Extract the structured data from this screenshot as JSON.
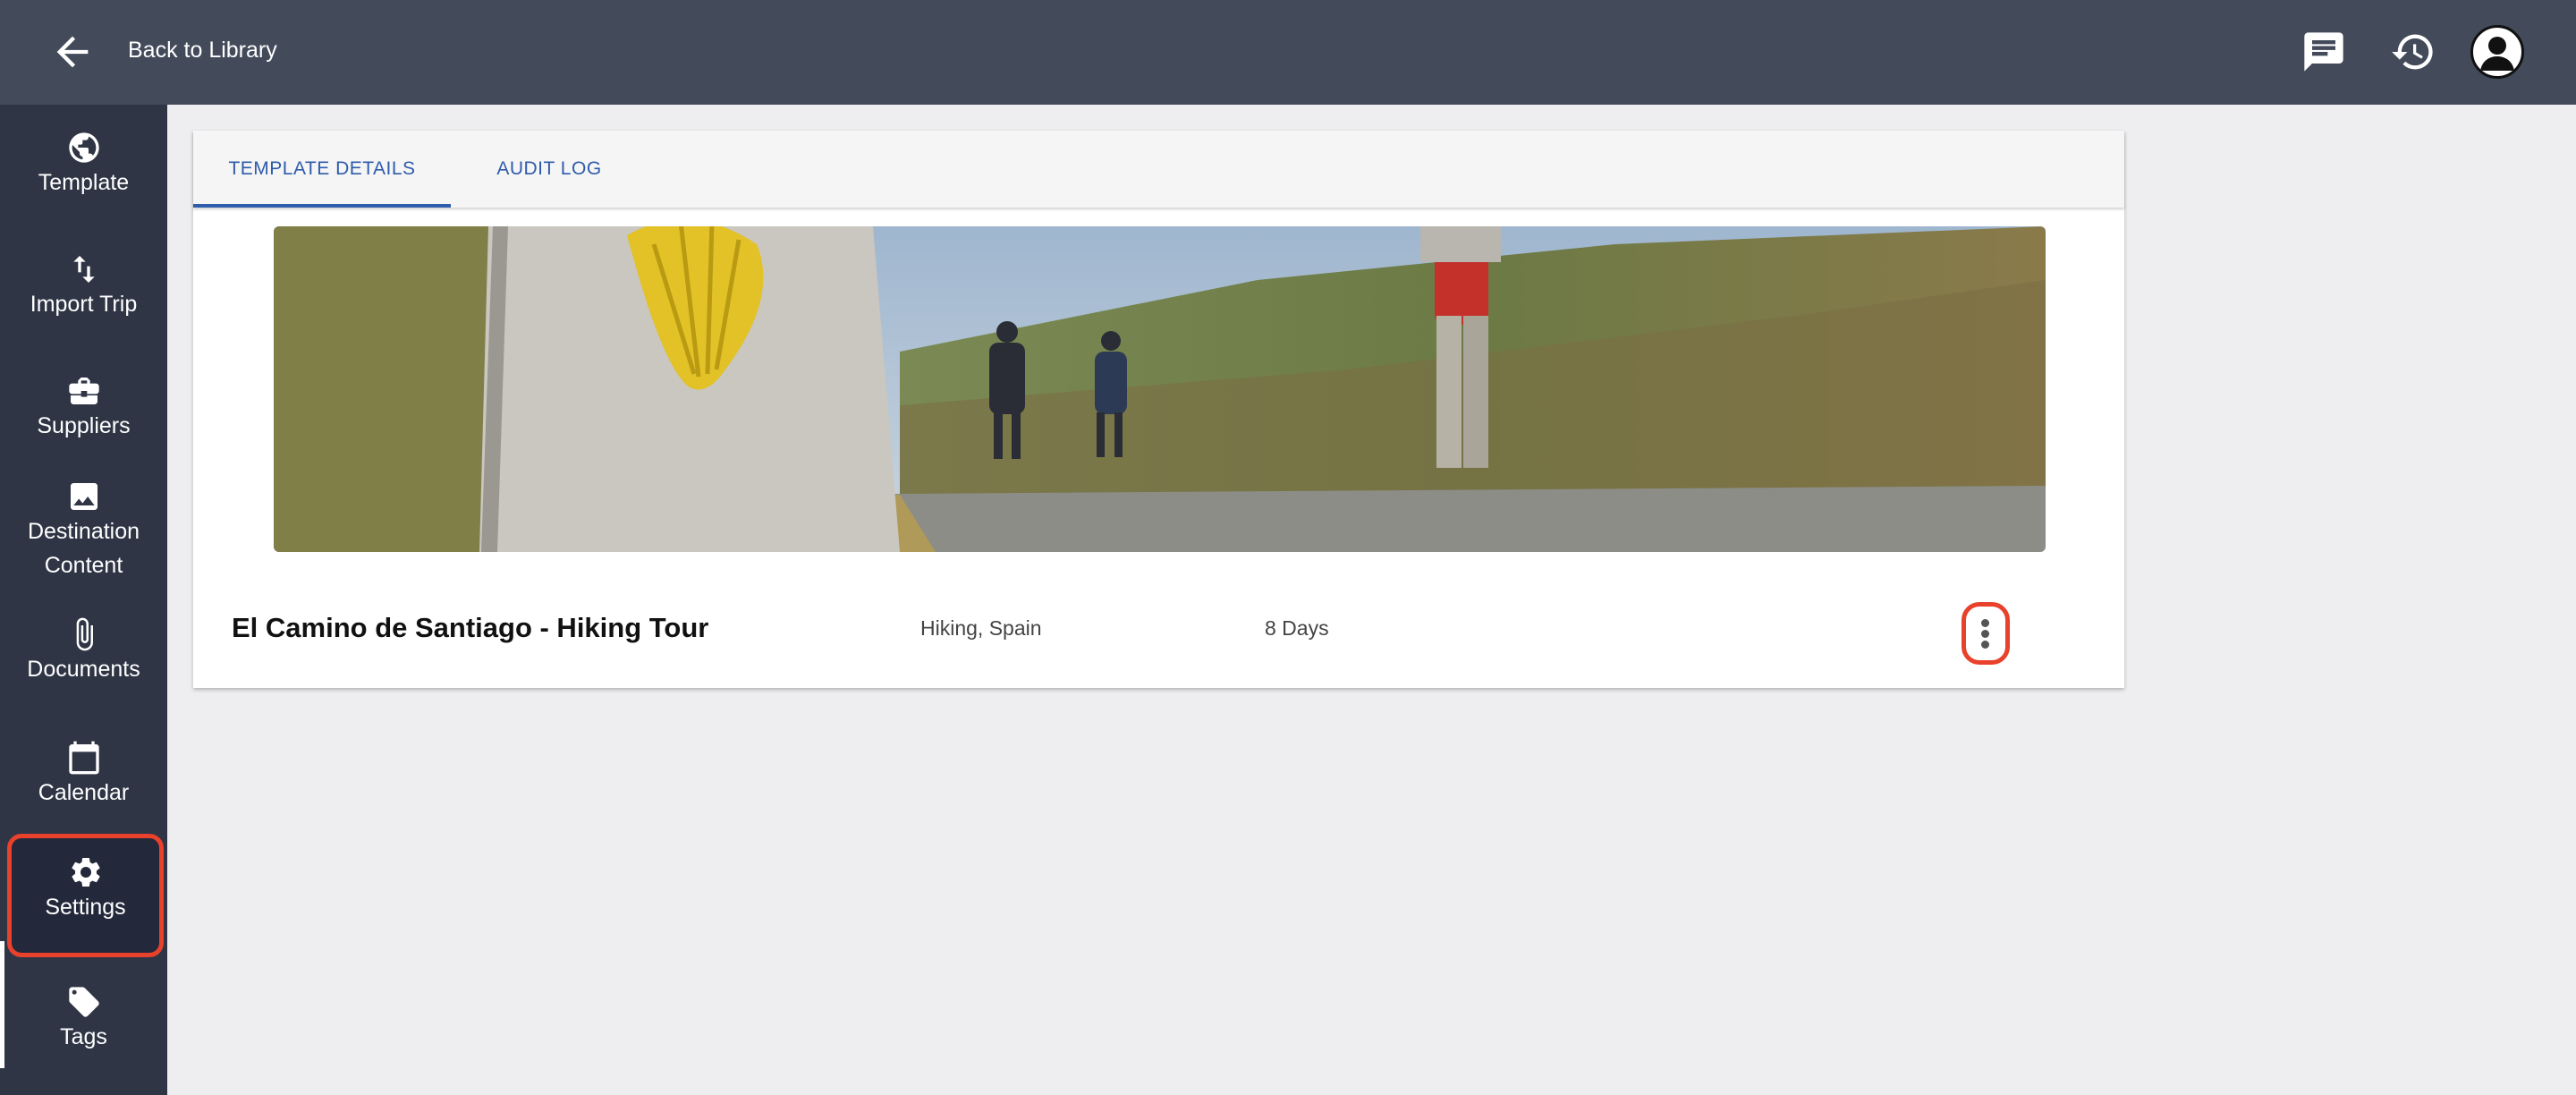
{
  "topbar": {
    "back_label": "Back to Library",
    "icons": [
      "back-arrow-icon",
      "chat-icon",
      "history-icon",
      "user-avatar"
    ]
  },
  "sidebar": {
    "items": [
      {
        "label": "Template",
        "icon": "globe-icon"
      },
      {
        "label": "Import Trip",
        "icon": "import-arrows-icon"
      },
      {
        "label": "Suppliers",
        "icon": "briefcase-icon"
      },
      {
        "label": "Destination Content",
        "icon": "image-icon"
      },
      {
        "label": "Documents",
        "icon": "paperclip-icon"
      },
      {
        "label": "Calendar",
        "icon": "calendar-icon"
      },
      {
        "label": "Settings",
        "icon": "gear-icon",
        "active": true
      },
      {
        "label": "Tags",
        "icon": "tag-icon"
      }
    ]
  },
  "tabs": [
    {
      "label": "TEMPLATE DETAILS",
      "active": true
    },
    {
      "label": "AUDIT LOG",
      "active": false
    }
  ],
  "trip": {
    "title": "El Camino de Santiago - Hiking Tour",
    "category": "Hiking, Spain",
    "duration": "8 Days"
  },
  "colors": {
    "topbar": "#434a5a",
    "sidebar": "#2f3545",
    "accent": "#2f5cab",
    "highlight": "#e8412c"
  }
}
